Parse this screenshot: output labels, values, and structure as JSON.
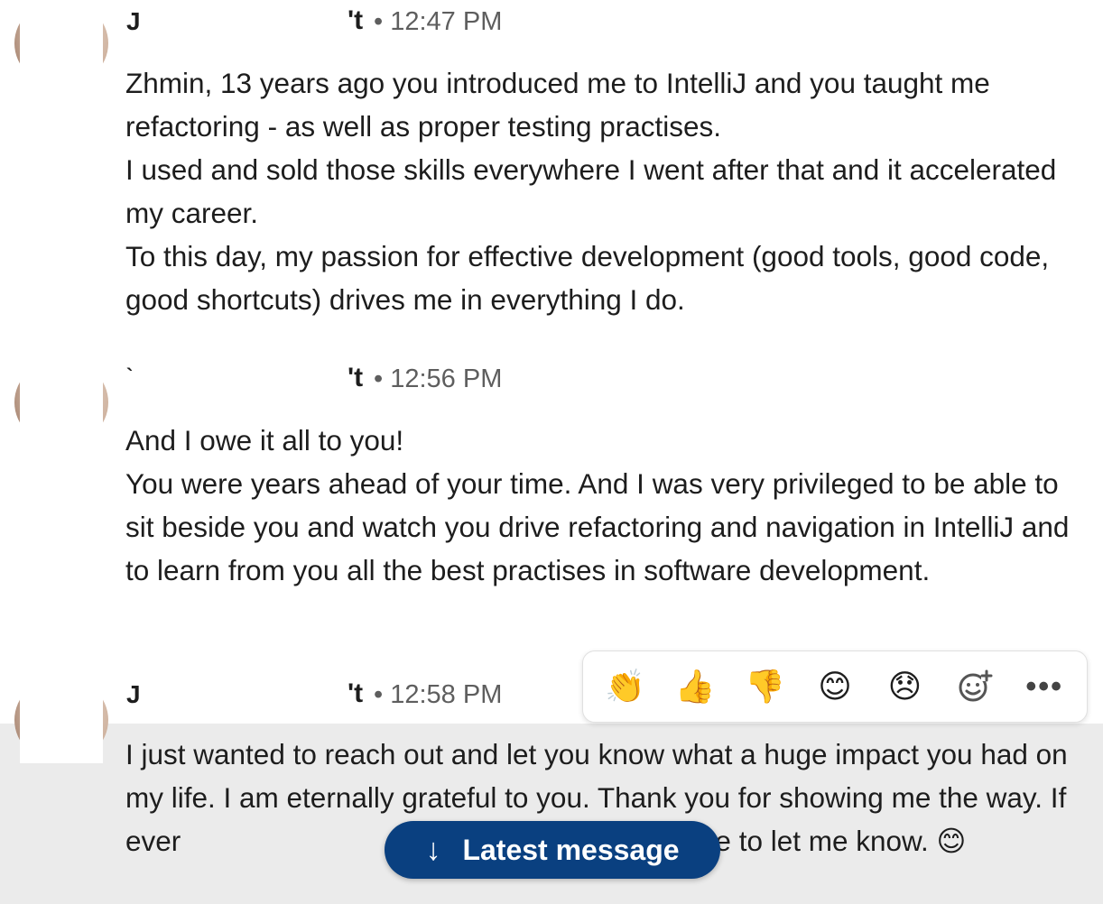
{
  "messages": [
    {
      "name_initial": "J",
      "name_fragment": "'t",
      "sep": "•",
      "time": "12:47 PM",
      "lines": [
        "Zhmin, 13 years ago you introduced me to IntelliJ and you taught me refactoring - as well as proper testing practises.",
        "I used and sold those skills everywhere I went after that and it accelerated my career.",
        "To this day, my passion for effective development (good tools, good code, good shortcuts) drives me in everything I do."
      ]
    },
    {
      "name_initial": "`",
      "name_fragment": "'t",
      "sep": "•",
      "time": "12:56 PM",
      "lines": [
        "And I owe it all to you!",
        "You were years ahead of your time. And I was very privileged to be able to sit beside you and watch you drive refactoring and navigation in IntelliJ and to learn from you all the best practises in software development."
      ]
    },
    {
      "name_initial": "J",
      "name_fragment": "'t",
      "sep": "•",
      "time": "12:58 PM",
      "lines": [
        "I just wanted to reach out and let you know what a huge impact you had on my life. I am eternally grateful to you. Thank you for showing me the way. If ever",
        "u, please be sure to let me know. 😊"
      ]
    }
  ],
  "reactions": [
    {
      "icon": "clapping-hands-icon",
      "glyph": "👏"
    },
    {
      "icon": "thumbs-up-icon",
      "glyph": "👍"
    },
    {
      "icon": "thumbs-down-icon",
      "glyph": "👎"
    },
    {
      "icon": "smile-icon",
      "glyph": "😊"
    },
    {
      "icon": "sad-face-icon",
      "glyph": "😞"
    },
    {
      "icon": "add-reaction-icon",
      "glyph": "☺"
    },
    {
      "icon": "more-icon",
      "glyph": "•••"
    }
  ],
  "latest_button": {
    "arrow": "↓",
    "label": "Latest message"
  },
  "colors": {
    "hover_row": "#ebebeb",
    "latest_button_bg": "#0a4080",
    "timestamp": "#5e5e5e"
  }
}
